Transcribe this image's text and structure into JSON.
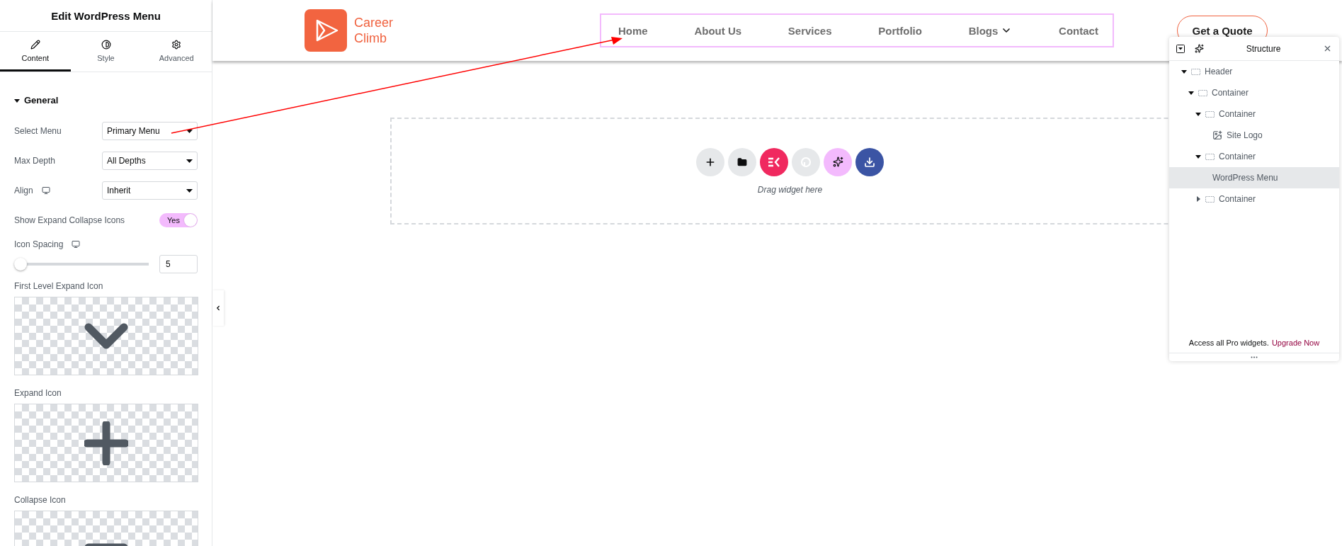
{
  "editor": {
    "title": "Edit WordPress Menu",
    "tabs": [
      {
        "label": "Content",
        "selected": true
      },
      {
        "label": "Style",
        "selected": false
      },
      {
        "label": "Advanced",
        "selected": false
      }
    ],
    "section": {
      "title": "General",
      "expanded": true
    },
    "controls": [
      {
        "kind": "select",
        "label": "Select Menu",
        "value": "Primary Menu",
        "responsive": false
      },
      {
        "kind": "select",
        "label": "Max Depth",
        "value": "All Depths",
        "responsive": false
      },
      {
        "kind": "select",
        "label": "Align",
        "value": "Inherit",
        "responsive": true
      },
      {
        "kind": "toggle",
        "label": "Show Expand Collapse Icons",
        "on": true,
        "value": "Yes"
      },
      {
        "kind": "slider",
        "label": "Icon Spacing",
        "level": 0,
        "value": "5",
        "responsive": true
      }
    ],
    "icon_pickers": [
      {
        "label": "First Level Expand Icon",
        "kind": "chevron"
      },
      {
        "label": "Expand Icon",
        "kind": "plus"
      },
      {
        "label": "Collapse Icon",
        "kind": "minus"
      }
    ]
  },
  "site_header": {
    "logo_lines": [
      "Career",
      "Climb"
    ],
    "nav": [
      {
        "label": "Home",
        "dropdown": false
      },
      {
        "label": "About Us",
        "dropdown": false
      },
      {
        "label": "Services",
        "dropdown": false
      },
      {
        "label": "Portfolio",
        "dropdown": false
      },
      {
        "label": "Blogs",
        "dropdown": true
      },
      {
        "label": "Contact",
        "dropdown": false
      }
    ],
    "button": "Get a Quote"
  },
  "drop_zone": {
    "buttons": [
      {
        "kind": "add",
        "color": "#e6e8ea"
      },
      {
        "kind": "folder",
        "color": "#e6e8ea"
      },
      {
        "kind": "kit",
        "color": "#f0295f"
      },
      {
        "kind": "pro",
        "color": "#e6e8ea"
      },
      {
        "kind": "ai",
        "color": "#f3bafd"
      },
      {
        "kind": "import",
        "color": "#3b54a4"
      }
    ],
    "hint": "Drag widget here"
  },
  "structure": {
    "title": "Structure",
    "tree": [
      {
        "label": "Header",
        "kind": "container",
        "expanded": true,
        "selected": false,
        "children": [
          {
            "label": "Container",
            "kind": "container",
            "expanded": true,
            "selected": false,
            "children": [
              {
                "label": "Container",
                "kind": "container",
                "expanded": true,
                "selected": false,
                "children": [
                  {
                    "label": "Site Logo",
                    "kind": "image",
                    "selected": false
                  }
                ]
              },
              {
                "label": "Container",
                "kind": "container",
                "expanded": true,
                "selected": false,
                "children": [
                  {
                    "label": "WordPress Menu",
                    "kind": "widget",
                    "selected": true
                  }
                ]
              },
              {
                "label": "Container",
                "kind": "container",
                "expanded": false,
                "selected": false
              }
            ]
          }
        ]
      }
    ],
    "footer_text": "Access all Pro widgets.",
    "footer_link": "Upgrade Now"
  }
}
